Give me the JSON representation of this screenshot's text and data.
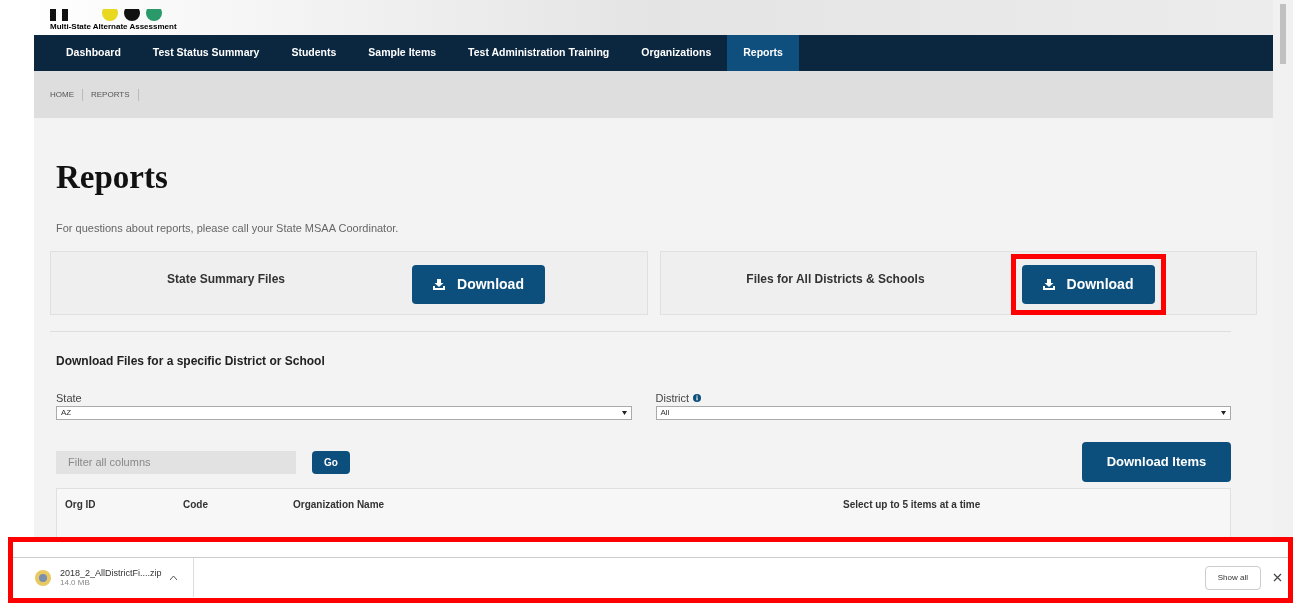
{
  "logo": {
    "tagline": "Multi-State Alternate Assessment"
  },
  "nav": [
    {
      "label": "Dashboard",
      "selected": false
    },
    {
      "label": "Test Status Summary",
      "selected": false
    },
    {
      "label": "Students",
      "selected": false
    },
    {
      "label": "Sample Items",
      "selected": false
    },
    {
      "label": "Test Administration Training",
      "selected": false
    },
    {
      "label": "Organizations",
      "selected": false
    },
    {
      "label": "Reports",
      "selected": true
    }
  ],
  "breadcrumb": [
    "HOME",
    "REPORTS"
  ],
  "heading": "Reports",
  "intro": "For questions about reports, please call your State MSAA Coordinator.",
  "cards": [
    {
      "title": "State Summary Files",
      "button": "Download",
      "highlighted": false
    },
    {
      "title": "Files for All Districts & Schools",
      "button": "Download",
      "highlighted": true
    }
  ],
  "section_title": "Download Files for a specific District or School",
  "selects": [
    {
      "label": "State",
      "value": "AZ",
      "info": false
    },
    {
      "label": "District",
      "value": "All",
      "info": true
    }
  ],
  "filter": {
    "placeholder": "Filter all columns",
    "go": "Go"
  },
  "download_items": "Download Items",
  "table": {
    "columns": [
      "Org ID",
      "Code",
      "Organization Name",
      "Select up to 5 items at a time"
    ]
  },
  "download_bar": {
    "file_name": "2018_2_AllDistrictFi....zip",
    "size": "14.0 MB",
    "show_all": "Show all",
    "highlighted": true
  }
}
